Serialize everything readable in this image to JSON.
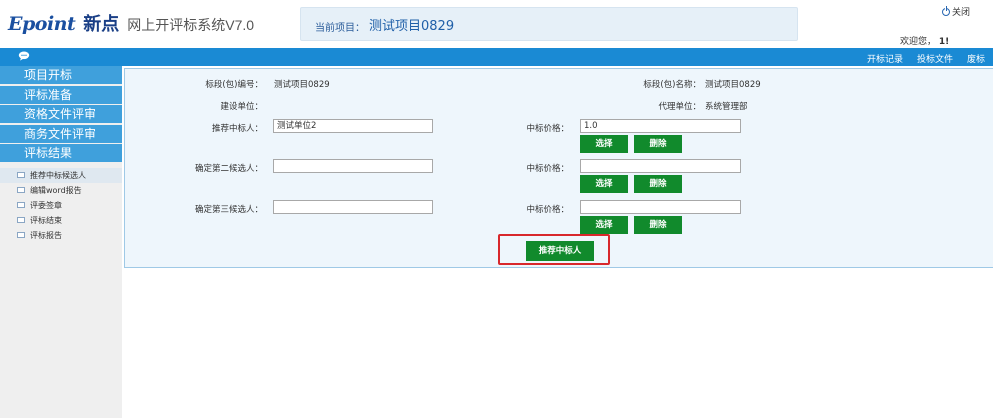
{
  "header": {
    "logo_brand": "Epoint",
    "logo_cn": "新点",
    "system_title": "网上开评标系统V7.0",
    "project_label": "当前项目：",
    "project_name": "测试项目0829",
    "close_label": "关闭",
    "welcome_text": "欢迎您，",
    "welcome_user": "1!"
  },
  "topnav": {
    "items": [
      "开标记录",
      "投标文件",
      "废标"
    ]
  },
  "sidebar": {
    "menu": [
      "项目开标",
      "评标准备",
      "资格文件评审",
      "商务文件评审",
      "评标结果"
    ],
    "submenu": [
      "推荐中标候选人",
      "编辑word报告",
      "评委签章",
      "评标结束",
      "评标报告"
    ],
    "active_index": 0
  },
  "form": {
    "section_no_label": "标段(包)编号：",
    "section_no_value": "测试项目0829",
    "section_name_label": "标段(包)名称：",
    "section_name_value": "测试项目0829",
    "builder_label": "建设单位：",
    "builder_value": "",
    "agent_label": "代理单位：",
    "agent_value": "系统管理部",
    "rows": [
      {
        "label": "推荐中标人：",
        "name_value": "测试单位2",
        "price_label": "中标价格：",
        "price_value": "1.0"
      },
      {
        "label": "确定第二候选人：",
        "name_value": "",
        "price_label": "中标价格：",
        "price_value": ""
      },
      {
        "label": "确定第三候选人：",
        "name_value": "",
        "price_label": "中标价格：",
        "price_value": ""
      }
    ],
    "select_label": "选择",
    "delete_label": "删除",
    "recommend_label": "推荐中标人"
  },
  "colors": {
    "accent_blue": "#1a8ad4",
    "menu_blue": "#3fa0dc",
    "button_green": "#118a2c",
    "highlight_red": "#d8282c"
  }
}
